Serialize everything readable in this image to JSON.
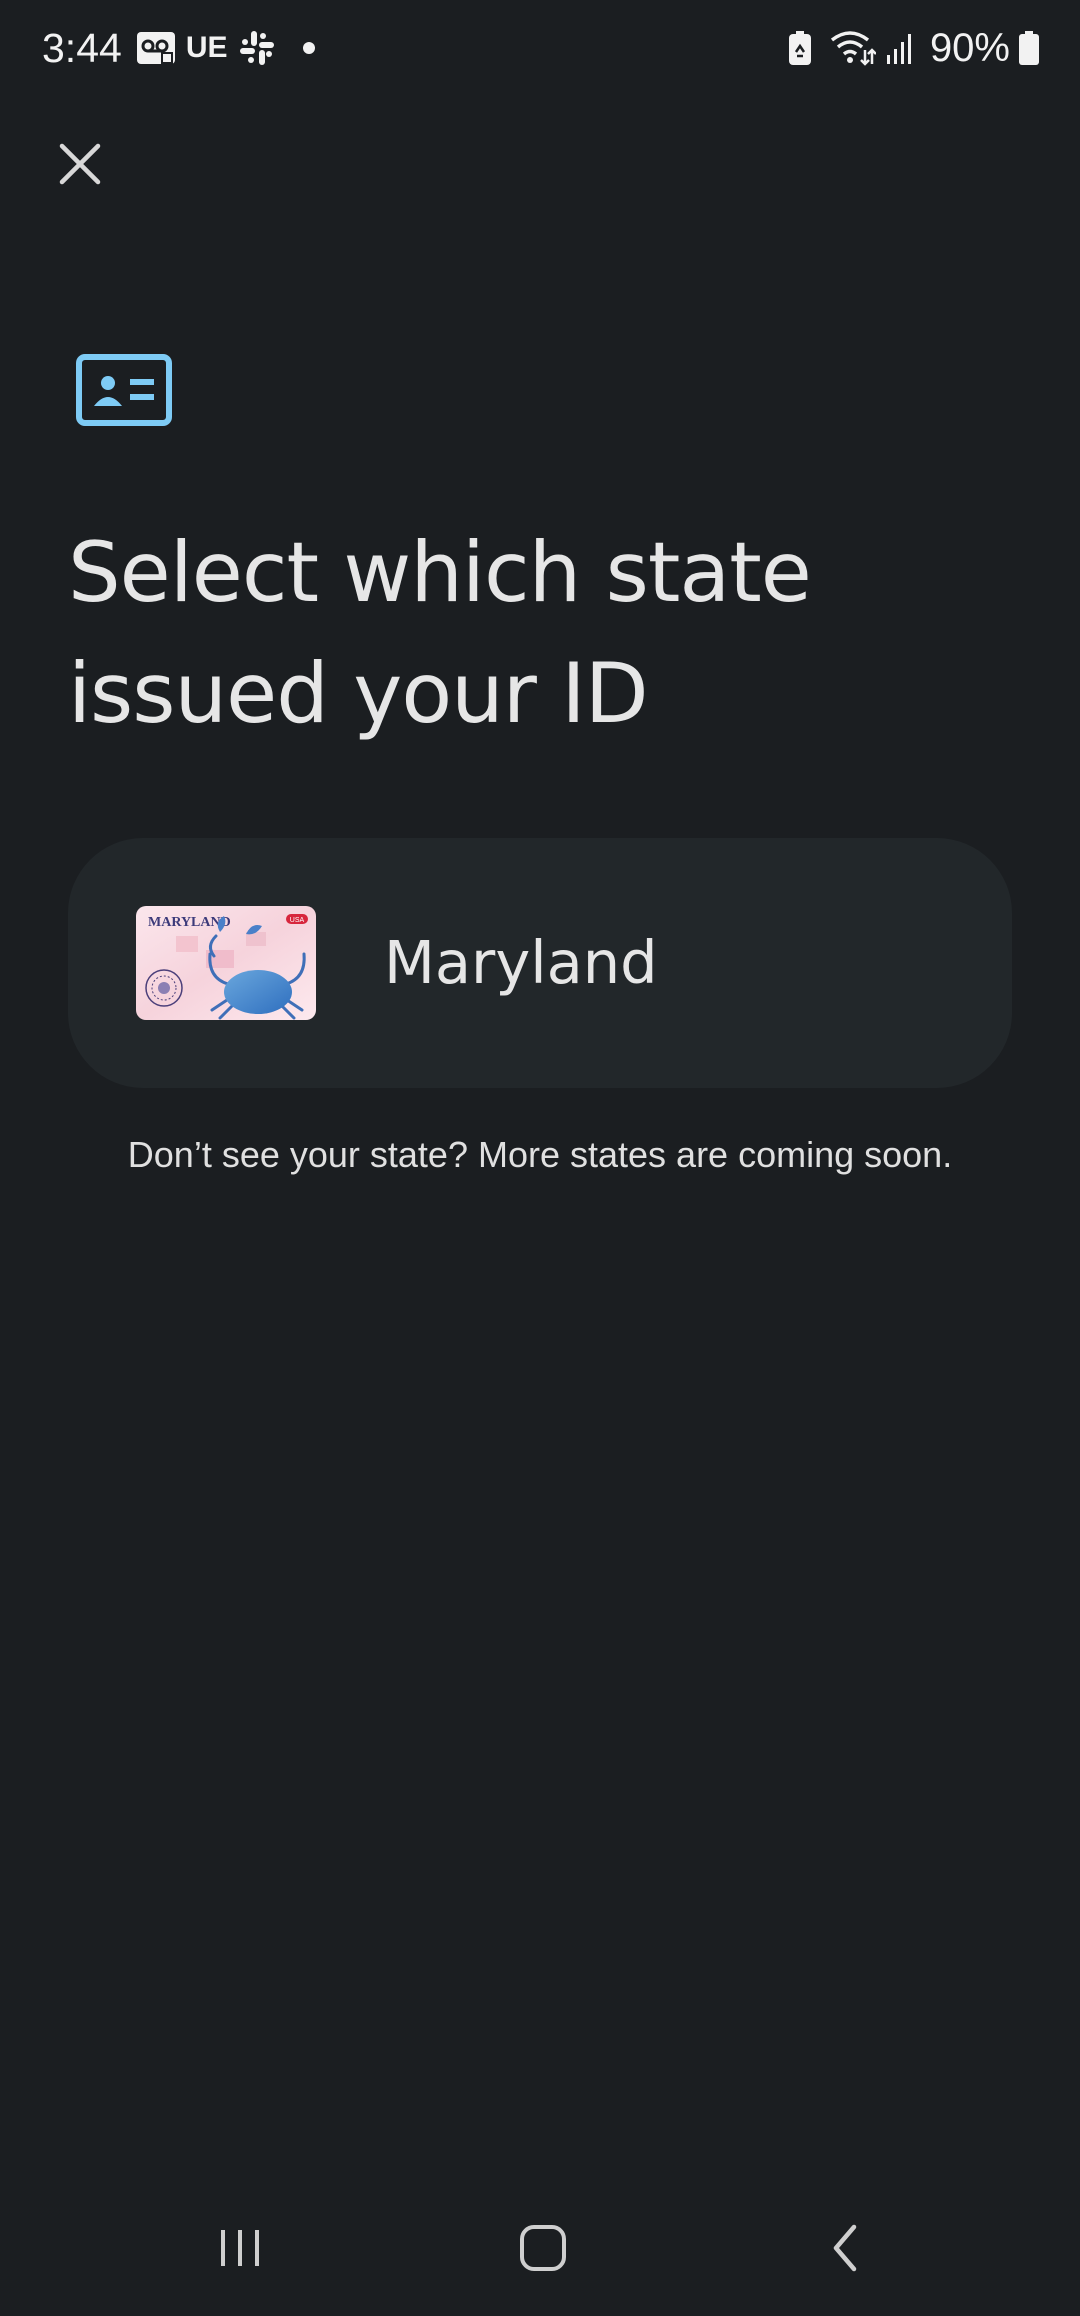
{
  "status_bar": {
    "time": "3:44",
    "carrier_label": "UE",
    "battery_percent": "90%",
    "icons": [
      "voicemail-icon",
      "slack-icon",
      "notification-dot-icon",
      "battery-saver-icon",
      "wifi-icon",
      "signal-icon",
      "battery-icon"
    ]
  },
  "header": {
    "close_icon": "close-icon"
  },
  "hero_icon": "id-card-icon",
  "title": "Select which state issued your ID",
  "states": [
    {
      "name": "Maryland",
      "card_label": "MARYLAND",
      "card_badge": "USA"
    }
  ],
  "footnote": "Don’t see your state? More states are coming soon.",
  "nav_bar": {
    "icons": [
      "recents-icon",
      "home-icon",
      "back-icon"
    ]
  },
  "colors": {
    "background": "#1b1e21",
    "card_background": "#22272a",
    "accent": "#7ecbf5",
    "text": "#e6e6e6"
  }
}
